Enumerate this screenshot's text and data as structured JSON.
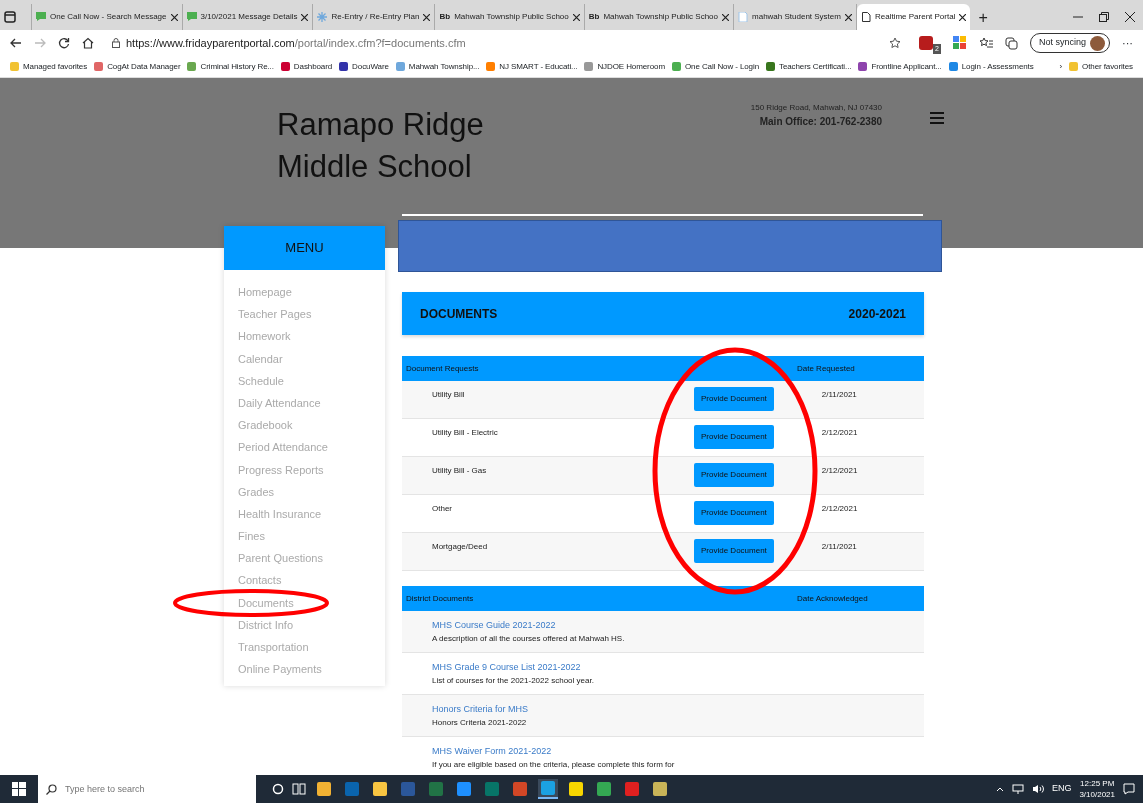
{
  "browser": {
    "tabs": [
      {
        "title": "One Call Now - Search Message",
        "kind": "chat",
        "selected": false
      },
      {
        "title": "3/10/2021 Message Details",
        "kind": "chat",
        "selected": false
      },
      {
        "title": "Re-Entry / Re-Entry Plan",
        "kind": "plan",
        "selected": false
      },
      {
        "title": "Mahwah Township Public Schoo",
        "icon_text": "Bb",
        "kind": "text",
        "selected": false
      },
      {
        "title": "Mahwah Township Public Schoo",
        "icon_text": "Bb",
        "kind": "text",
        "selected": false
      },
      {
        "title": "mahwah Student System",
        "kind": "system",
        "selected": false
      },
      {
        "title": "Realtime Parent Portal",
        "kind": "page",
        "selected": true
      }
    ],
    "new_tab": "+",
    "url_host": "https://www.fridayparentportal.com",
    "url_path": "/portal/index.cfm?f=documents.cfm",
    "extension_badge": "2",
    "sync_button": "Not syncing",
    "more": "···",
    "bookmarks": [
      {
        "label": "Managed favorites",
        "color": "#f1c232"
      },
      {
        "label": "CogAt Data Manager",
        "color": "#e06666"
      },
      {
        "label": "Criminal History Re...",
        "color": "#6aa84f"
      },
      {
        "label": "Dashboard",
        "color": "#cc0033"
      },
      {
        "label": "DocuWare",
        "color": "#3333aa"
      },
      {
        "label": "Mahwah Township...",
        "color": "#6fa8dc"
      },
      {
        "label": "NJ SMART - Educati...",
        "color": "#ff7f00"
      },
      {
        "label": "NJDOE Homeroom",
        "color": "#999999"
      },
      {
        "label": "One Call Now - Login",
        "color": "#4caf50"
      },
      {
        "label": "Teachers Certificati...",
        "color": "#38761d"
      },
      {
        "label": "Frontline Applicant...",
        "color": "#8e44ad"
      },
      {
        "label": "Login - Assessments",
        "color": "#1e88e5"
      }
    ],
    "bookmarks_more": "›",
    "other_favorites": "Other favorites"
  },
  "site": {
    "school_name": [
      "Ramapo Ridge",
      "Middle School"
    ],
    "address": "150 Ridge Road, Mahwah, NJ 07430",
    "phone": "Main Office: 201-762-2380",
    "menu": {
      "title": "MENU",
      "items": [
        {
          "label": "Homepage",
          "circled": false
        },
        {
          "label": "Teacher Pages",
          "circled": false
        },
        {
          "label": "Homework",
          "circled": false
        },
        {
          "label": "Calendar",
          "circled": false
        },
        {
          "label": "Schedule",
          "circled": false
        },
        {
          "label": "Daily Attendance",
          "circled": false
        },
        {
          "label": "Gradebook",
          "circled": false
        },
        {
          "label": "Period Attendance",
          "circled": false
        },
        {
          "label": "Progress Reports",
          "circled": false
        },
        {
          "label": "Grades",
          "circled": false
        },
        {
          "label": "Health Insurance",
          "circled": false
        },
        {
          "label": "Fines",
          "circled": false
        },
        {
          "label": "Parent Questions",
          "circled": false
        },
        {
          "label": "Contacts",
          "circled": false
        },
        {
          "label": "Documents",
          "circled": true
        },
        {
          "label": "District Info",
          "circled": false
        },
        {
          "label": "Transportation",
          "circled": false
        },
        {
          "label": "Online Payments",
          "circled": false
        }
      ]
    },
    "documents": {
      "title": "DOCUMENTS",
      "year": "2020-2021",
      "requests": {
        "columns": [
          "Document Requests",
          "Date Requested"
        ],
        "buttons_circled": true,
        "rows": [
          {
            "name": "Utility Bill",
            "button": "Provide Document",
            "date": "2/11/2021"
          },
          {
            "name": "Utility Bill - Electric",
            "button": "Provide Document",
            "date": "2/12/2021"
          },
          {
            "name": "Utility Bill - Gas",
            "button": "Provide Document",
            "date": "2/12/2021"
          },
          {
            "name": "Other",
            "button": "Provide Document",
            "date": "2/12/2021"
          },
          {
            "name": "Mortgage/Deed",
            "button": "Provide Document",
            "date": "2/11/2021"
          }
        ]
      },
      "district": {
        "columns": [
          "District Documents",
          "Date Acknowledged"
        ],
        "rows": [
          {
            "title": "MHS Course Guide 2021-2022",
            "description": "A description of all the courses offered at Mahwah HS."
          },
          {
            "title": "MHS Grade 9 Course List 2021-2022",
            "description": "List of courses for the 2021-2022 school year."
          },
          {
            "title": "Honors Criteria for MHS",
            "description": "Honors Criteria 2021-2022"
          },
          {
            "title": "MHS Waiver Form 2021-2022",
            "description": "If you are eligible based on the criteria, please complete this form for"
          }
        ]
      }
    }
  },
  "taskbar": {
    "search_placeholder": "Type here to search",
    "apps": [
      {
        "color": "#f2b233",
        "selected": false
      },
      {
        "color": "#0a64ad",
        "selected": false
      },
      {
        "color": "#f8c542",
        "selected": false
      },
      {
        "color": "#2b579a",
        "selected": false
      },
      {
        "color": "#217346",
        "selected": false
      },
      {
        "color": "#1e90ff",
        "selected": false
      },
      {
        "color": "#077568",
        "selected": false
      },
      {
        "color": "#d24726",
        "selected": false
      },
      {
        "color": "#1ba1e2",
        "selected": true
      },
      {
        "color": "#f7d600",
        "selected": false
      },
      {
        "color": "#34a853",
        "selected": false
      },
      {
        "color": "#e02020",
        "selected": false
      },
      {
        "color": "#c9b458",
        "selected": false
      }
    ],
    "language": "ENG",
    "time": "12:25 PM",
    "date": "3/10/2021"
  }
}
